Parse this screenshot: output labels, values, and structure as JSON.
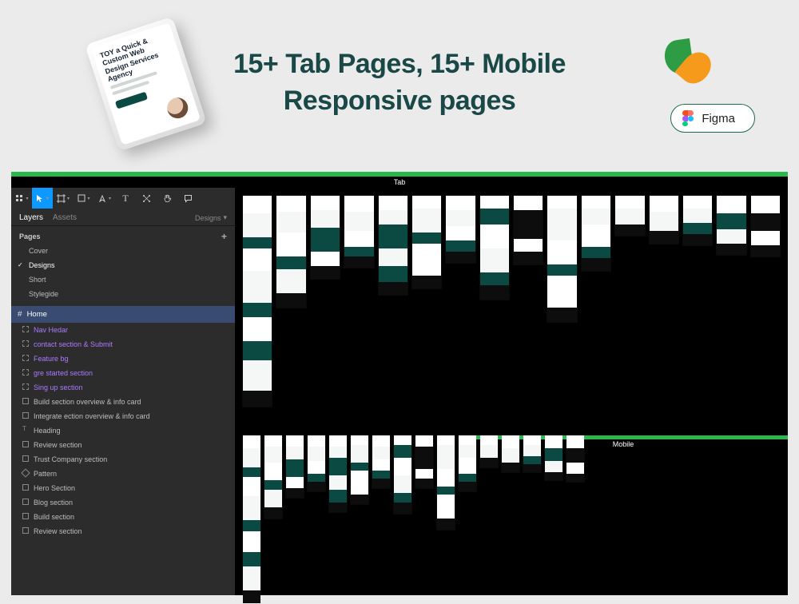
{
  "hero": {
    "title_line1": "15+ Tab Pages, 15+ Mobile",
    "title_line2": "Responsive pages",
    "tablet_heading": "TOY a Quick & Custom Web Design Services Agency",
    "figma_label": "Figma"
  },
  "editor": {
    "section_tab_label": "Tab",
    "section_mobile_label": "Mobile",
    "panel": {
      "tabs": {
        "layers": "Layers",
        "assets": "Assets",
        "designs": "Designs"
      },
      "pages_label": "Pages",
      "pages": [
        {
          "name": "Cover",
          "selected": false
        },
        {
          "name": "Designs",
          "selected": true
        },
        {
          "name": "Short",
          "selected": false
        },
        {
          "name": "Stylegide",
          "selected": false
        }
      ],
      "selected_frame": "Home",
      "layers": [
        {
          "name": "Nav Hedar",
          "kind": "group",
          "hl": true
        },
        {
          "name": "contact section & Submit",
          "kind": "group",
          "hl": true
        },
        {
          "name": "Feature bg",
          "kind": "group",
          "hl": true
        },
        {
          "name": "gre started section",
          "kind": "group",
          "hl": true
        },
        {
          "name": "Sing up section",
          "kind": "group",
          "hl": true
        },
        {
          "name": "Build section overview & info card",
          "kind": "rect",
          "hl": false
        },
        {
          "name": "Integrate ection overview & info card",
          "kind": "rect",
          "hl": false
        },
        {
          "name": "Heading",
          "kind": "text",
          "hl": false
        },
        {
          "name": "Review section",
          "kind": "rect",
          "hl": false
        },
        {
          "name": "Trust Company section",
          "kind": "rect",
          "hl": false
        },
        {
          "name": "Pattern",
          "kind": "comp",
          "hl": false
        },
        {
          "name": "Hero Section",
          "kind": "rect",
          "hl": false
        },
        {
          "name": "Blog section",
          "kind": "rect",
          "hl": false
        },
        {
          "name": "Build section",
          "kind": "rect",
          "hl": false
        },
        {
          "name": "Review section",
          "kind": "rect",
          "hl": false
        }
      ]
    },
    "artboards_tab": [
      {
        "sections": [
          [
            "white",
            22
          ],
          [
            "light",
            30
          ],
          [
            "teal",
            14
          ],
          [
            "white",
            28
          ],
          [
            "light",
            40
          ],
          [
            "teal",
            18
          ],
          [
            "white",
            30
          ],
          [
            "teal",
            24
          ],
          [
            "light",
            38
          ],
          [
            "dark",
            20
          ]
        ]
      },
      {
        "sections": [
          [
            "white",
            20
          ],
          [
            "light",
            26
          ],
          [
            "white",
            30
          ],
          [
            "teal",
            16
          ],
          [
            "light",
            30
          ],
          [
            "dark",
            18
          ]
        ]
      },
      {
        "sections": [
          [
            "white",
            18
          ],
          [
            "light",
            22
          ],
          [
            "teal",
            30
          ],
          [
            "white",
            18
          ],
          [
            "dark",
            16
          ]
        ]
      },
      {
        "sections": [
          [
            "white",
            20
          ],
          [
            "light",
            24
          ],
          [
            "white",
            20
          ],
          [
            "teal",
            12
          ],
          [
            "dark",
            14
          ]
        ]
      },
      {
        "sections": [
          [
            "white",
            18
          ],
          [
            "light",
            18
          ],
          [
            "teal",
            30
          ],
          [
            "light",
            22
          ],
          [
            "teal",
            20
          ],
          [
            "dark",
            16
          ]
        ]
      },
      {
        "sections": [
          [
            "white",
            16
          ],
          [
            "light",
            30
          ],
          [
            "teal",
            14
          ],
          [
            "white",
            40
          ],
          [
            "dark",
            16
          ]
        ]
      },
      {
        "sections": [
          [
            "white",
            18
          ],
          [
            "light",
            20
          ],
          [
            "white",
            18
          ],
          [
            "teal",
            14
          ],
          [
            "dark",
            14
          ]
        ]
      },
      {
        "sections": [
          [
            "white",
            16
          ],
          [
            "teal",
            20
          ],
          [
            "white",
            30
          ],
          [
            "light",
            30
          ],
          [
            "teal",
            16
          ],
          [
            "dark",
            18
          ]
        ]
      },
      {
        "sections": [
          [
            "white",
            18
          ],
          [
            "dark",
            36
          ],
          [
            "white",
            16
          ],
          [
            "dark",
            16
          ]
        ]
      },
      {
        "sections": [
          [
            "white",
            16
          ],
          [
            "light",
            40
          ],
          [
            "white",
            30
          ],
          [
            "teal",
            14
          ],
          [
            "white",
            40
          ],
          [
            "dark",
            18
          ]
        ]
      },
      {
        "sections": [
          [
            "white",
            16
          ],
          [
            "light",
            20
          ],
          [
            "white",
            28
          ],
          [
            "teal",
            14
          ],
          [
            "dark",
            16
          ]
        ]
      },
      {
        "sections": [
          [
            "white",
            16
          ],
          [
            "light",
            20
          ],
          [
            "dark",
            14
          ]
        ]
      },
      {
        "sections": [
          [
            "white",
            20
          ],
          [
            "light",
            24
          ],
          [
            "dark",
            16
          ]
        ]
      },
      {
        "sections": [
          [
            "white",
            16
          ],
          [
            "light",
            18
          ],
          [
            "teal",
            14
          ],
          [
            "dark",
            14
          ]
        ]
      },
      {
        "sections": [
          [
            "white",
            22
          ],
          [
            "teal",
            20
          ],
          [
            "light",
            18
          ],
          [
            "dark",
            14
          ]
        ]
      },
      {
        "sections": [
          [
            "white",
            22
          ],
          [
            "dark",
            22
          ],
          [
            "white",
            18
          ],
          [
            "dark",
            14
          ]
        ]
      }
    ],
    "artboards_mobile": [
      {
        "sections": [
          [
            "white",
            16
          ],
          [
            "light",
            24
          ],
          [
            "teal",
            12
          ],
          [
            "white",
            24
          ],
          [
            "light",
            30
          ],
          [
            "teal",
            14
          ],
          [
            "white",
            26
          ],
          [
            "teal",
            18
          ],
          [
            "light",
            30
          ],
          [
            "dark",
            16
          ]
        ]
      },
      {
        "sections": [
          [
            "white",
            14
          ],
          [
            "light",
            20
          ],
          [
            "white",
            22
          ],
          [
            "teal",
            12
          ],
          [
            "light",
            22
          ],
          [
            "dark",
            14
          ]
        ]
      },
      {
        "sections": [
          [
            "white",
            14
          ],
          [
            "light",
            16
          ],
          [
            "teal",
            22
          ],
          [
            "white",
            14
          ],
          [
            "dark",
            12
          ]
        ]
      },
      {
        "sections": [
          [
            "white",
            14
          ],
          [
            "light",
            18
          ],
          [
            "white",
            16
          ],
          [
            "teal",
            10
          ],
          [
            "dark",
            12
          ]
        ]
      },
      {
        "sections": [
          [
            "white",
            14
          ],
          [
            "light",
            14
          ],
          [
            "teal",
            22
          ],
          [
            "light",
            18
          ],
          [
            "teal",
            16
          ],
          [
            "dark",
            12
          ]
        ]
      },
      {
        "sections": [
          [
            "white",
            12
          ],
          [
            "light",
            22
          ],
          [
            "teal",
            10
          ],
          [
            "white",
            30
          ],
          [
            "dark",
            12
          ]
        ]
      },
      {
        "sections": [
          [
            "white",
            14
          ],
          [
            "light",
            16
          ],
          [
            "white",
            14
          ],
          [
            "teal",
            10
          ],
          [
            "dark",
            12
          ]
        ]
      },
      {
        "sections": [
          [
            "white",
            12
          ],
          [
            "teal",
            16
          ],
          [
            "white",
            22
          ],
          [
            "light",
            22
          ],
          [
            "teal",
            12
          ],
          [
            "dark",
            14
          ]
        ]
      },
      {
        "sections": [
          [
            "white",
            14
          ],
          [
            "dark",
            28
          ],
          [
            "white",
            12
          ],
          [
            "dark",
            12
          ]
        ]
      },
      {
        "sections": [
          [
            "white",
            12
          ],
          [
            "light",
            30
          ],
          [
            "white",
            22
          ],
          [
            "teal",
            10
          ],
          [
            "white",
            30
          ],
          [
            "dark",
            14
          ]
        ]
      },
      {
        "sections": [
          [
            "white",
            12
          ],
          [
            "light",
            16
          ],
          [
            "white",
            20
          ],
          [
            "teal",
            10
          ],
          [
            "dark",
            12
          ]
        ]
      },
      {
        "sections": [
          [
            "white",
            12
          ],
          [
            "light",
            16
          ],
          [
            "dark",
            12
          ]
        ]
      },
      {
        "sections": [
          [
            "white",
            16
          ],
          [
            "light",
            18
          ],
          [
            "dark",
            12
          ]
        ]
      },
      {
        "sections": [
          [
            "white",
            12
          ],
          [
            "light",
            14
          ],
          [
            "teal",
            10
          ],
          [
            "dark",
            10
          ]
        ]
      },
      {
        "sections": [
          [
            "white",
            16
          ],
          [
            "teal",
            16
          ],
          [
            "light",
            14
          ],
          [
            "dark",
            10
          ]
        ]
      },
      {
        "sections": [
          [
            "white",
            16
          ],
          [
            "dark",
            18
          ],
          [
            "white",
            14
          ],
          [
            "dark",
            10
          ]
        ]
      }
    ]
  }
}
